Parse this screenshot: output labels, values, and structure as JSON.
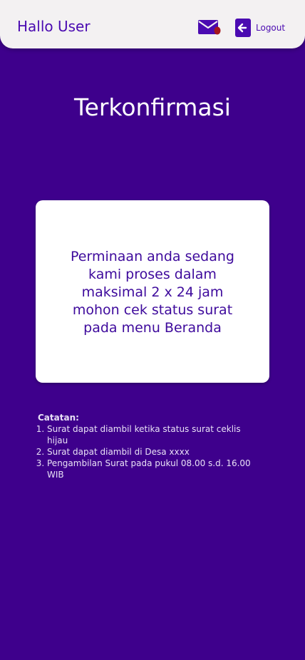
{
  "header": {
    "greeting": "Hallo User",
    "mail_icon": "mail-icon",
    "logout_icon": "arrow-left-icon",
    "logout_label": "Logout"
  },
  "main": {
    "title": "Terkonfirmasi",
    "message": "Perminaan anda sedang kami proses dalam maksimal 2 x 24 jam mohon cek status surat pada menu Beranda"
  },
  "notes": {
    "title": "Catatan:",
    "items": [
      "Surat dapat diambil ketika status surat ceklis hijau",
      "Surat dapat diambil di Desa xxxx",
      "Pengambilan Surat pada pukul 08.00 s.d. 16.00 WIB"
    ]
  },
  "colors": {
    "background": "#3e008c",
    "header_bg": "#f3f1f2",
    "accent": "#4a0ab1",
    "notification_dot": "#a3161e",
    "card_bg": "#ffffff"
  }
}
